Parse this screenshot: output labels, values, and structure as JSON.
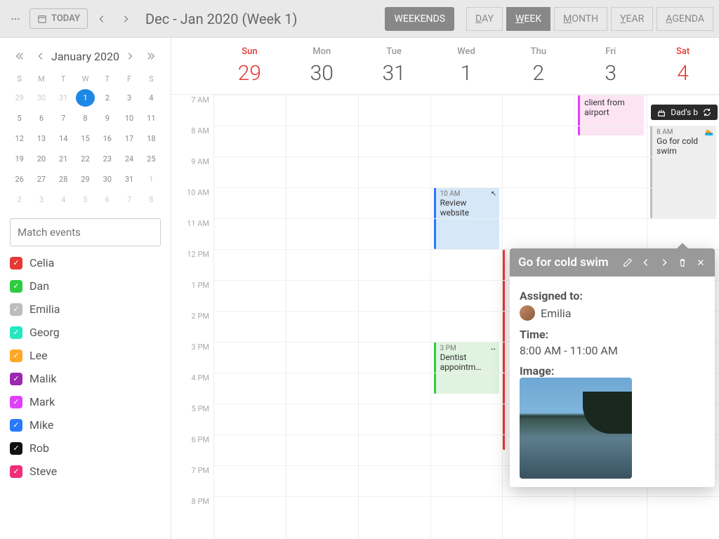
{
  "toolbar": {
    "today": "TODAY",
    "title": "Dec - Jan 2020 (Week 1)",
    "views": {
      "weekends": "WEEKENDS",
      "day": "DAY",
      "week": "WEEK",
      "month": "MONTH",
      "year": "YEAR",
      "agenda": "AGENDA"
    }
  },
  "mini": {
    "title": "January 2020",
    "dow": [
      "S",
      "M",
      "T",
      "W",
      "T",
      "F",
      "S"
    ],
    "rows": [
      [
        "29",
        "30",
        "31",
        "1",
        "2",
        "3",
        "4"
      ],
      [
        "5",
        "6",
        "7",
        "8",
        "9",
        "10",
        "11"
      ],
      [
        "12",
        "13",
        "14",
        "15",
        "16",
        "17",
        "18"
      ],
      [
        "19",
        "20",
        "21",
        "22",
        "23",
        "24",
        "25"
      ],
      [
        "26",
        "27",
        "28",
        "29",
        "30",
        "31",
        "1"
      ],
      [
        "2",
        "3",
        "4",
        "5",
        "6",
        "7",
        "8"
      ]
    ]
  },
  "search": {
    "placeholder": "Match events"
  },
  "resources": [
    {
      "name": "Celia",
      "color": "#e53935"
    },
    {
      "name": "Dan",
      "color": "#2ecc40"
    },
    {
      "name": "Emilia",
      "color": "#bdbdbd"
    },
    {
      "name": "Georg",
      "color": "#26e6c2"
    },
    {
      "name": "Lee",
      "color": "#ffa726"
    },
    {
      "name": "Malik",
      "color": "#9c27b0"
    },
    {
      "name": "Mark",
      "color": "#e040fb"
    },
    {
      "name": "Mike",
      "color": "#2979ff"
    },
    {
      "name": "Rob",
      "color": "#111"
    },
    {
      "name": "Steve",
      "color": "#ef2d7a"
    }
  ],
  "days": [
    {
      "dow": "Sun",
      "num": "29",
      "weekend": true
    },
    {
      "dow": "Mon",
      "num": "30"
    },
    {
      "dow": "Tue",
      "num": "31"
    },
    {
      "dow": "Wed",
      "num": "1"
    },
    {
      "dow": "Thu",
      "num": "2"
    },
    {
      "dow": "Fri",
      "num": "3"
    },
    {
      "dow": "Sat",
      "num": "4",
      "weekend": true
    }
  ],
  "hours": [
    "7 AM",
    "8 AM",
    "9 AM",
    "10 AM",
    "11 AM",
    "12 PM",
    "1 PM",
    "2 PM",
    "3 PM",
    "4 PM",
    "5 PM",
    "6 PM",
    "7 PM",
    "8 PM"
  ],
  "allday": {
    "label": "Dad's b"
  },
  "events": {
    "airport": {
      "title": "client from airport",
      "bg": "#fce4f3",
      "border": "#e040fb"
    },
    "review": {
      "time": "10 AM",
      "title": "Review website",
      "bg": "#d6e7f7",
      "border": "#2979ff"
    },
    "dentist": {
      "time": "3 PM",
      "title": "Dentist appointm…",
      "bg": "#e0f3e0",
      "border": "#2ecc40"
    },
    "swim": {
      "time": "8 AM",
      "title": "Go for cold swim",
      "bg": "#eeeeee",
      "border": "#bdbdbd"
    },
    "red1": {
      "bg": "#ffebee",
      "border": "#e53935"
    },
    "red2": {
      "bg": "#ffebee",
      "border": "#e53935"
    }
  },
  "tooltip": {
    "title": "Go for cold swim",
    "assigned_label": "Assigned to:",
    "assignee": "Emilia",
    "time_label": "Time:",
    "time": "8:00 AM - 11:00 AM",
    "image_label": "Image:"
  }
}
